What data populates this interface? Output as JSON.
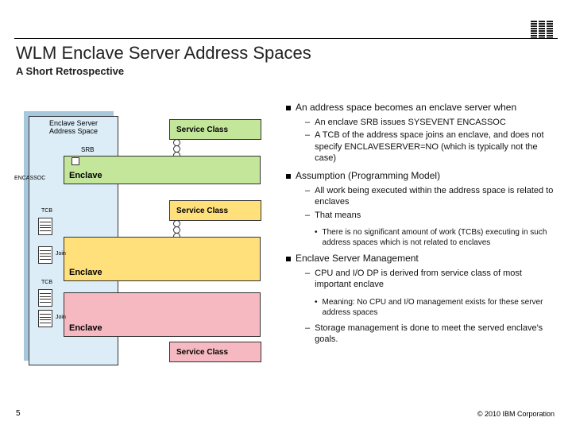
{
  "header": {
    "title": "WLM Enclave Server Address Spaces",
    "subtitle": "A Short Retrospective",
    "logo_name": "ibm-logo"
  },
  "footer": {
    "page": "5",
    "copyright": "© 2010 IBM Corporation"
  },
  "diagram": {
    "as_box_line1": "Enclave Server",
    "as_box_line2": "Address Space",
    "service_class": "Service Class",
    "enclave": "Enclave",
    "srb": "SRB",
    "encassoc": "ENCASSOC",
    "tcb": "TCB",
    "join": "Join"
  },
  "bullets": {
    "b1": "An address space becomes an enclave server when",
    "b1_sub": [
      "An enclave SRB issues SYSEVENT ENCASSOC",
      "A TCB of the address space joins an enclave, and does not specify ENCLAVESERVER=NO (which is typically not the case)"
    ],
    "b2": "Assumption (Programming Model)",
    "b2_sub": [
      "All work being executed within the address space is related to enclaves",
      "That means"
    ],
    "b2_dot": [
      "There is no significant amount of work (TCBs) executing in such address spaces which is not related to enclaves"
    ],
    "b3": "Enclave Server Management",
    "b3_sub1": "CPU and I/O DP is derived from service class of most important enclave",
    "b3_dot": [
      "Meaning: No CPU and I/O management exists for these server address spaces"
    ],
    "b3_sub2": "Storage management is done to meet the served enclave's goals."
  }
}
